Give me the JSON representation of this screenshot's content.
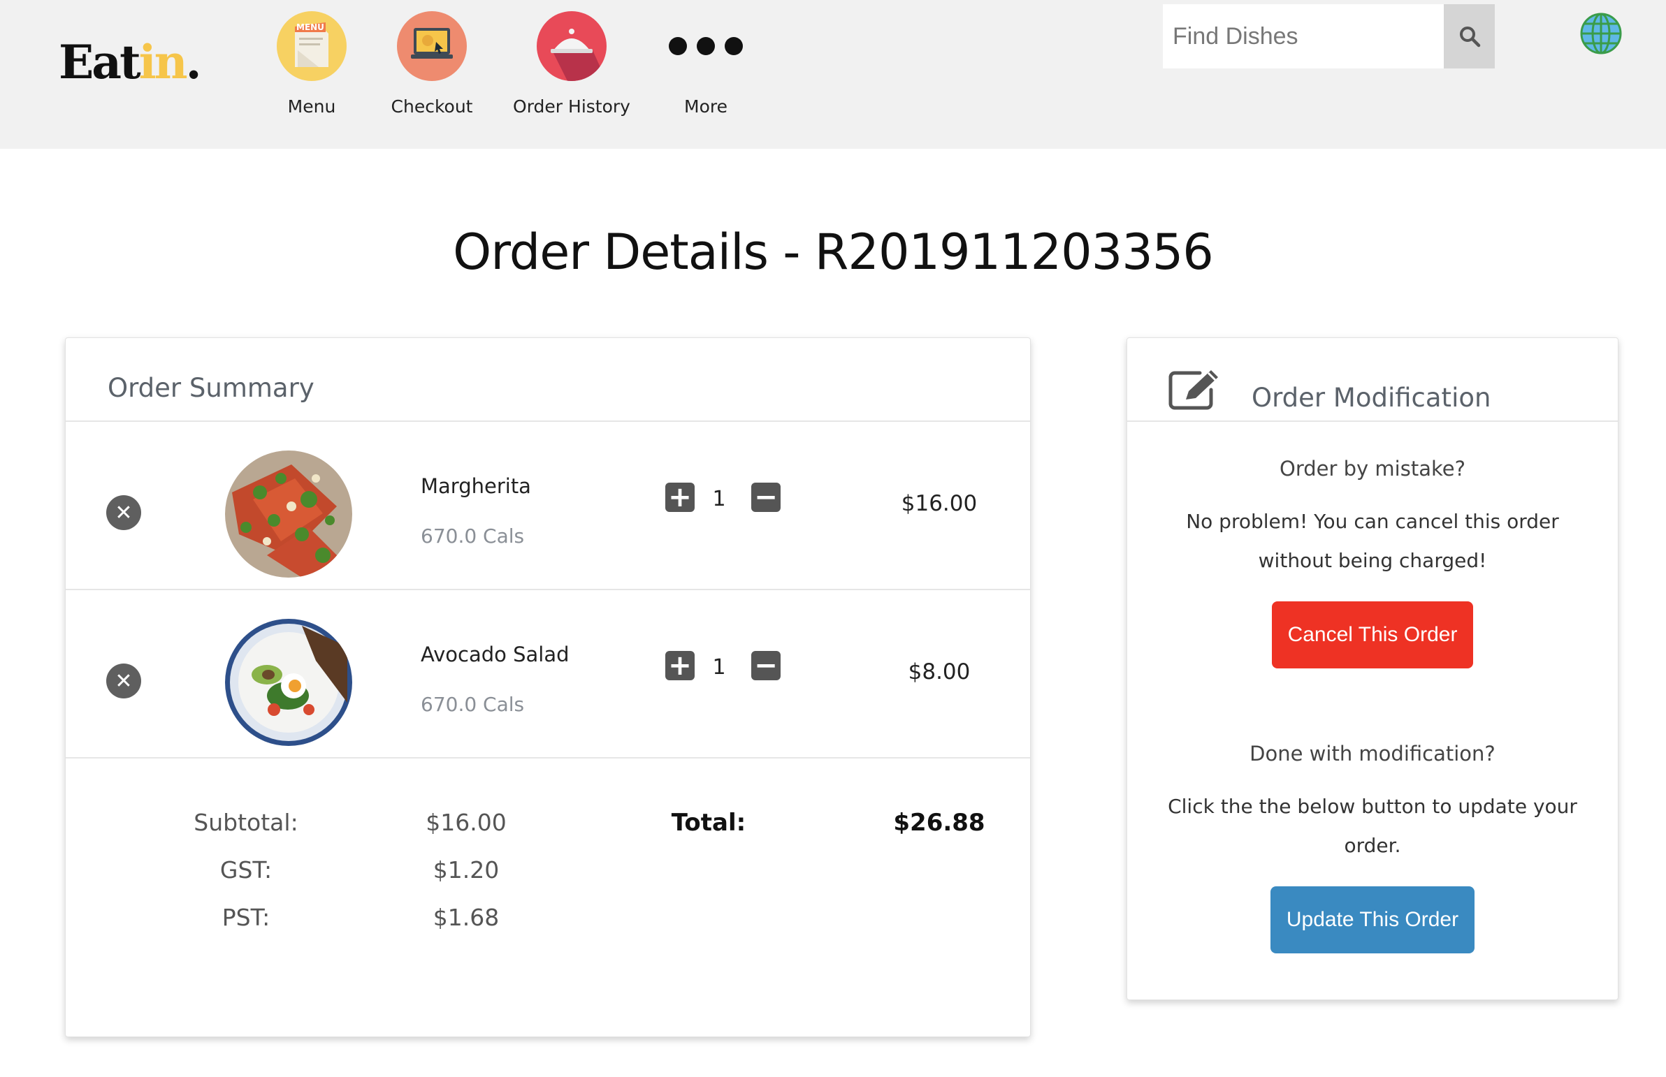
{
  "header": {
    "logo_main": "Eat",
    "logo_accent": "in",
    "logo_dot": ".",
    "nav": [
      {
        "label": "Menu",
        "icon": "menu-icon",
        "color": "#f7d162"
      },
      {
        "label": "Checkout",
        "icon": "checkout-icon",
        "color": "#ee8b6f"
      },
      {
        "label": "Order History",
        "icon": "order-history-icon",
        "color": "#e84a58"
      },
      {
        "label": "More",
        "icon": "more-icon"
      }
    ],
    "menu_badge": "MENU",
    "search": {
      "placeholder": "Find Dishes",
      "value": ""
    }
  },
  "page": {
    "title": "Order Details - R201911203356"
  },
  "summary": {
    "title": "Order Summary",
    "items": [
      {
        "name": "Margherita",
        "cals": "670.0 Cals",
        "qty": "1",
        "price": "$16.00"
      },
      {
        "name": "Avocado Salad",
        "cals": "670.0 Cals",
        "qty": "1",
        "price": "$8.00"
      }
    ],
    "totals": {
      "subtotal_label": "Subtotal:",
      "subtotal": "$16.00",
      "gst_label": "GST:",
      "gst": "$1.20",
      "pst_label": "PST:",
      "pst": "$1.68",
      "total_label": "Total:",
      "total": "$26.88"
    }
  },
  "modification": {
    "title": "Order Modification",
    "cancel_heading": "Order by mistake?",
    "cancel_text_1": "No problem! You can cancel this order",
    "cancel_text_2": "without being charged!",
    "cancel_button": "Cancel This Order",
    "update_heading": "Done with modification?",
    "update_text_1": "Click the the below button to update your",
    "update_text_2": "order.",
    "update_button": "Update This Order"
  },
  "colors": {
    "accent_yellow": "#f6c54a",
    "cancel_red": "#ee3224",
    "update_blue": "#3a8ac1",
    "header_bg": "#f1f1f1"
  }
}
